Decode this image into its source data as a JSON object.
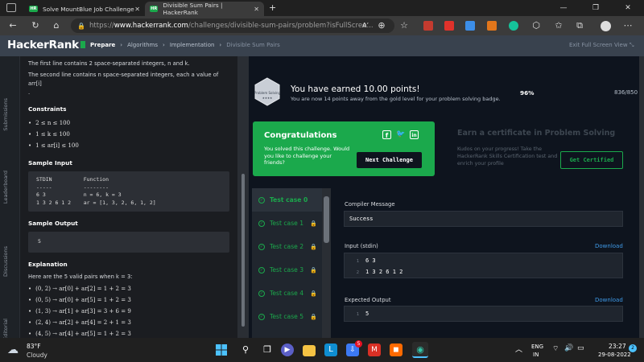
{
  "browser": {
    "tabs": [
      {
        "favicon": "HR",
        "title": "Solve MountBlue Job Challenge",
        "active": false
      },
      {
        "favicon": "HR",
        "title": "Divisible Sum Pairs | HackerRank",
        "active": true
      }
    ],
    "new_tab": "+",
    "url_prefix": "https://",
    "url_host": "www.hackerrank.com",
    "url_path": "/challenges/divisible-sum-pairs/problem?isFullScree...",
    "window_controls": [
      "—",
      "❐",
      "✕"
    ]
  },
  "header": {
    "logo": "HackerRank",
    "breadcrumb": [
      "Prepare",
      "Algorithms",
      "Implementation",
      "Divisible Sum Pairs"
    ],
    "exit_fullscreen": "Exit Full Screen View"
  },
  "sidebar": {
    "labels": [
      "Submissions",
      "Leaderboard",
      "Discussions",
      "Editorial"
    ]
  },
  "problem": {
    "input_line1": "The first line contains 2 space-separated integers, n and k.",
    "input_line2": "The second line contains n space-separated integers, each a value of arr[i]",
    "input_line3": ".",
    "constraints_title": "Constraints",
    "constraints": [
      "2 ≤ n ≤ 100",
      "1 ≤ k ≤ 100",
      "1 ≤ ar[i] ≤ 100"
    ],
    "sample_input_title": "Sample Input",
    "sample_input": "STDIN          Function\n-----          --------\n6 3            n = 6, k = 3\n1 3 2 6 1 2    ar = [1, 3, 2, 6, 1, 2]",
    "sample_output_title": "Sample Output",
    "sample_output": "5",
    "explanation_title": "Explanation",
    "explanation_intro": "Here are the 5 valid pairs when k = 3:",
    "pairs": [
      "(0, 2) → ar[0] + ar[2] = 1 + 2 = 3",
      "(0, 5) → ar[0] + ar[5] = 1 + 2 = 3",
      "(1, 3) → ar[1] + ar[3] = 3 + 6 = 9",
      "(2, 4) → ar[2] + ar[4] = 2 + 1 = 3",
      "(4, 5) → ar[4] + ar[5] = 1 + 2 = 3"
    ]
  },
  "result": {
    "badge_label": "Problem Solving",
    "earned": "You have earned 10.00 points!",
    "earned_sub": "You are now 14 points away from the gold level for your problem solving badge.",
    "progress_pct": "96%",
    "progress_value": 0.96,
    "points": "836/850",
    "congrats_title": "Congratulations",
    "congrats_body": "You solved this challenge. Would you like to challenge your friends?",
    "next_button": "Next Challenge",
    "cert_title": "Earn a certificate in Problem Solving",
    "cert_body": "Kudos on your progress! Take the HackerRank Skills Certification test and enrich your profile",
    "cert_button": "Get Certified"
  },
  "testcases": [
    {
      "label": "Test case 0",
      "locked": false
    },
    {
      "label": "Test case 1",
      "locked": true
    },
    {
      "label": "Test case 2",
      "locked": true
    },
    {
      "label": "Test case 3",
      "locked": true
    },
    {
      "label": "Test case 4",
      "locked": true
    },
    {
      "label": "Test case 5",
      "locked": true
    }
  ],
  "output": {
    "compiler_label": "Compiler Message",
    "compiler_value": "Success",
    "input_label": "Input (stdin)",
    "download": "Download",
    "input_lines": [
      {
        "n": "1",
        "text": "6 3"
      },
      {
        "n": "2",
        "text": "1 3 2 6 1 2"
      }
    ],
    "expected_label": "Expected Output",
    "expected_lines": [
      {
        "n": "1",
        "text": "5"
      }
    ]
  },
  "taskbar": {
    "temp": "83°F",
    "weather": "Cloudy",
    "lang1": "ENG",
    "lang2": "IN",
    "time": "23:27",
    "date": "29-08-2022",
    "notif_count": "5"
  },
  "colors": {
    "accent": "#1ba94c",
    "header": "#39424e",
    "link": "#3f9ae8"
  }
}
